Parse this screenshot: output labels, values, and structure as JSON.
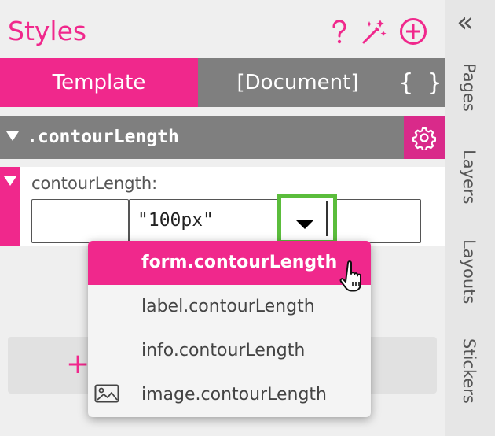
{
  "header": {
    "title": "Styles"
  },
  "tabs": {
    "template": "Template",
    "document": "[Document]",
    "code": "{ }"
  },
  "section": {
    "name": ".contourLength"
  },
  "property": {
    "label": "contourLength:",
    "value": "\"100px\""
  },
  "menu": {
    "items": [
      {
        "label": "form.contourLength"
      },
      {
        "label": "label.contourLength"
      },
      {
        "label": "info.contourLength"
      },
      {
        "label": "image.contourLength"
      }
    ]
  },
  "add": {
    "symbol": "+"
  },
  "rail": {
    "collapse": "«",
    "items": [
      {
        "label": "Pages"
      },
      {
        "label": "Layers"
      },
      {
        "label": "Layouts"
      },
      {
        "label": "Stickers"
      }
    ]
  },
  "colors": {
    "accent": "#f0288c",
    "accent_dark": "#d92a8a",
    "gray_bar": "#7f7f7f",
    "highlight": "#5bbd3c"
  }
}
